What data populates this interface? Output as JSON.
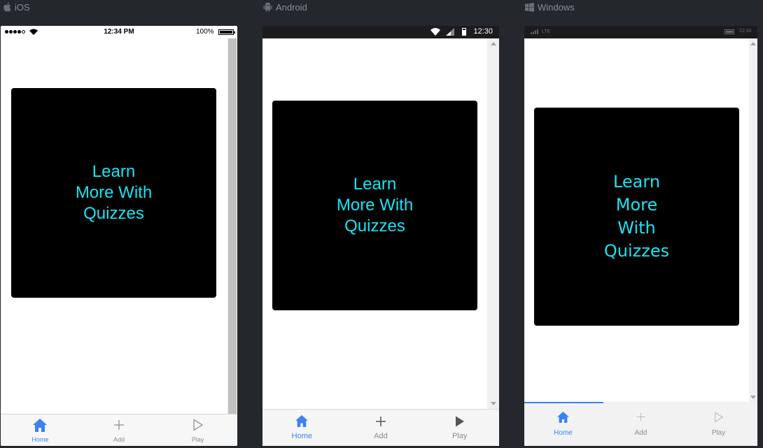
{
  "platforms": [
    {
      "id": "ios",
      "label": "iOS",
      "icon": "apple-icon"
    },
    {
      "id": "android",
      "label": "Android",
      "icon": "android-icon"
    },
    {
      "id": "windows",
      "label": "Windows",
      "icon": "windows-icon"
    }
  ],
  "ios": {
    "status_time": "12:34 PM",
    "battery_text": "100%",
    "card_text": "Learn More With Quizzes"
  },
  "android": {
    "status_time": "12:30",
    "card_text": "Learn More With Quizzes"
  },
  "windows": {
    "network": "LTE",
    "status_time": "12:34",
    "card_text": "Learn More With Quizzes"
  },
  "tabs": [
    {
      "label": "Home",
      "icon": "home-icon",
      "active": true
    },
    {
      "label": "Add",
      "icon": "plus-icon",
      "active": false
    },
    {
      "label": "Play",
      "icon": "play-icon",
      "active": false
    }
  ],
  "colors": {
    "accent": "#3c82f0",
    "card_text": "#19e3f2",
    "card_background": "#000000",
    "page_background": "#24272c"
  }
}
